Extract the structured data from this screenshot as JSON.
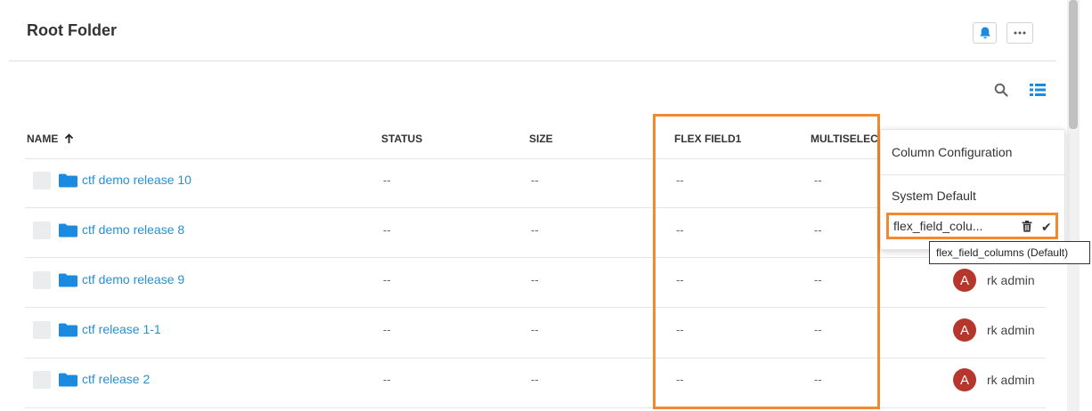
{
  "header": {
    "title": "Root Folder"
  },
  "table": {
    "columns": {
      "name": "NAME",
      "status": "STATUS",
      "size": "SIZE",
      "flex_field1": "FLEX FIELD1",
      "multiselect": "MULTISELECT"
    },
    "rows": [
      {
        "name": "ctf demo release 10",
        "status": "--",
        "size": "--",
        "flex_field1": "--",
        "multiselect": "--",
        "owner_initial": "",
        "owner": ""
      },
      {
        "name": "ctf demo release 8",
        "status": "--",
        "size": "--",
        "flex_field1": "--",
        "multiselect": "--",
        "owner_initial": "",
        "owner": ""
      },
      {
        "name": "ctf demo release 9",
        "status": "--",
        "size": "--",
        "flex_field1": "--",
        "multiselect": "--",
        "owner_initial": "A",
        "owner": "rk admin"
      },
      {
        "name": "ctf release 1-1",
        "status": "--",
        "size": "--",
        "flex_field1": "--",
        "multiselect": "--",
        "owner_initial": "A",
        "owner": "rk admin"
      },
      {
        "name": "ctf release 2",
        "status": "--",
        "size": "--",
        "flex_field1": "--",
        "multiselect": "--",
        "owner_initial": "A",
        "owner": "rk admin"
      }
    ]
  },
  "column_config_menu": {
    "title": "Column Configuration",
    "items": [
      {
        "label": "System Default"
      },
      {
        "label": "flex_field_colu...",
        "selected": true
      }
    ],
    "tooltip": "flex_field_columns (Default)"
  },
  "colors": {
    "accent": "#2a8fd0",
    "highlight": "#f0892f",
    "avatar": "#b5362b"
  },
  "icons": {
    "bell": "bell-icon",
    "more": "ellipsis-icon",
    "search": "search-icon",
    "columns": "column-config-icon",
    "sort": "arrow-up-icon",
    "folder": "folder-icon",
    "trash": "trash-icon",
    "check": "check-icon"
  }
}
